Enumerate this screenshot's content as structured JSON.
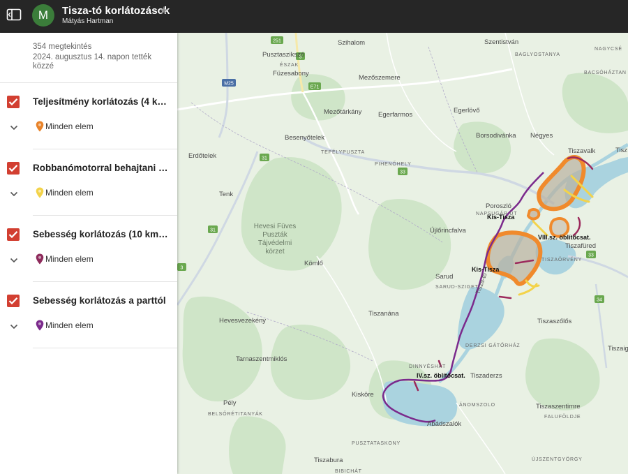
{
  "header": {
    "title": "Tisza-tó korlátozások",
    "author": "Mátyás Hartman",
    "avatar_letter": "M"
  },
  "info": {
    "views": "354 megtekintés",
    "published": "2024. augusztus 14. napon tették közzé"
  },
  "layers": [
    {
      "name": "Teljesítmény korlátozás (4 kW)",
      "item": "Minden elem",
      "pin_color": "#e8832a",
      "checked": true
    },
    {
      "name": "Robbanómotorral behajtani tilos",
      "item": "Minden elem",
      "pin_color": "#f3d34a",
      "checked": true
    },
    {
      "name": "Sebesség korlátozás (10 km/h)",
      "item": "Minden elem",
      "pin_color": "#8e2b5c",
      "checked": true
    },
    {
      "name": "Sebesség korlátozás a parttól",
      "item": "Minden elem",
      "pin_color": "#7b2a8c",
      "checked": true
    }
  ],
  "map": {
    "towns": [
      "Szihalom",
      "Szentistván",
      "Pusztaszikszó",
      "Füzesabony",
      "Mezőszemere",
      "Mezőtárkány",
      "Egerfarmos",
      "Egerlövő",
      "Borsodivánka",
      "Négyes",
      "Tiszavalk",
      "Besenyőtelek",
      "Erdőtelek",
      "Tenk",
      "Poroszló",
      "Újlőrincfalva",
      "Tiszafüred",
      "Sarud",
      "Kömlő",
      "Tiszanána",
      "Hevesvezekény",
      "Tarnaszentmiklós",
      "Tiszaszőlős",
      "Tiszaderzs",
      "Kisköre",
      "Tiszaszentimre",
      "Abádszalók",
      "Pély",
      "Tiszabura",
      "Tiszaig",
      "Tisz"
    ],
    "districts": [
      "BAGLYOSTANYA",
      "NAGYCSÉ",
      "BACSÓHÁZTAN",
      "ÉSZAK",
      "TEPÉLYPUSZTA",
      "PIHENŐHELY",
      "NAPSUGÁR ÚT",
      "TISZAÖRVÉNY",
      "SARUD-SZIGET",
      "DERZSI GÁTŐRHÁZ",
      "DINNYÉSHÁT",
      "ÁNOMSZOLO",
      "FALUFÖLDJE",
      "BELSŐRÉTITANYÁK",
      "PUSZTATASKONY",
      "ÚJSZENTGYÖRGY",
      "BIBICHÁT"
    ],
    "park": [
      "Hevesi Füves",
      "Puszták",
      "Tájvédelmi",
      "körzet"
    ],
    "lake_labels": [
      "Kis-Tisza",
      "Kis-Tisza",
      "VIII.sz. öblítőcsat.",
      "IV.sz. öblítőcsat."
    ],
    "roads": [
      "251",
      "3",
      "M25",
      "E71",
      "31",
      "33",
      "33",
      "31",
      "34",
      "3"
    ],
    "river": "Tisza-tó"
  }
}
